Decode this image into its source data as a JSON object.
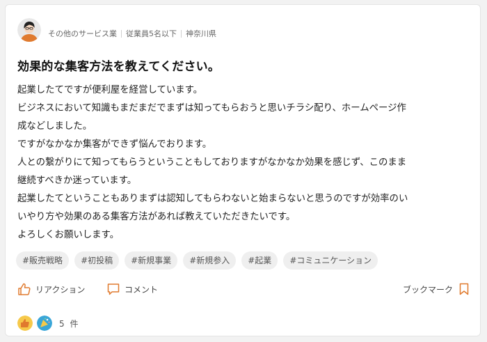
{
  "post": {
    "author": {
      "industry": "その他のサービス業",
      "company_size": "従業員5名以下",
      "region": "神奈川県"
    },
    "title": "効果的な集客方法を教えてください。",
    "body_lines": [
      "起業したてですが便利屋を経営しています。",
      "ビジネスにおいて知識もまだまだでまずは知ってもらおうと思いチラシ配り、ホームページ作",
      "成などしました。",
      "ですがなかなか集客ができず悩んでおります。",
      "人との繋がりにて知ってもらうということもしておりますがなかなか効果を感じず、このまま",
      "継続すべきか迷っています。",
      "起業したてということもありまずは認知してもらわないと始まらないと思うのですが効率のい",
      "いやり方や効果のある集客方法があれば教えていただきたいです。",
      "よろしくお願いします。"
    ],
    "tags": [
      "#販売戦略",
      "#初投稿",
      "#新規事業",
      "#新規参入",
      "#起業",
      "#コミュニケーション"
    ]
  },
  "actions": {
    "reaction_label": "リアクション",
    "comment_label": "コメント",
    "bookmark_label": "ブックマーク"
  },
  "reactions": {
    "count_label": "5 件",
    "icons": [
      "thumbs-up-reaction-icon",
      "party-reaction-icon"
    ]
  },
  "colors": {
    "accent": "#e07a2e",
    "avatar_bg": "#e8e8e8",
    "tag_bg": "#efefef"
  }
}
